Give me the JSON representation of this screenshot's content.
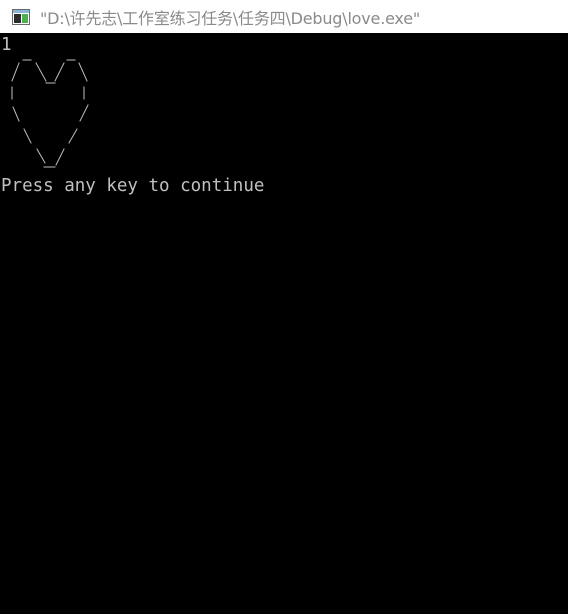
{
  "window": {
    "title": "\"D:\\许先志\\工作室练习任务\\任务四\\Debug\\love.exe\"",
    "icon": "console-window-icon"
  },
  "console": {
    "first_line": "1",
    "heart_art": "ascii-heart",
    "prompt_line": "Press any key to continue",
    "text_color": "#c0c0c0",
    "background": "#000000"
  }
}
